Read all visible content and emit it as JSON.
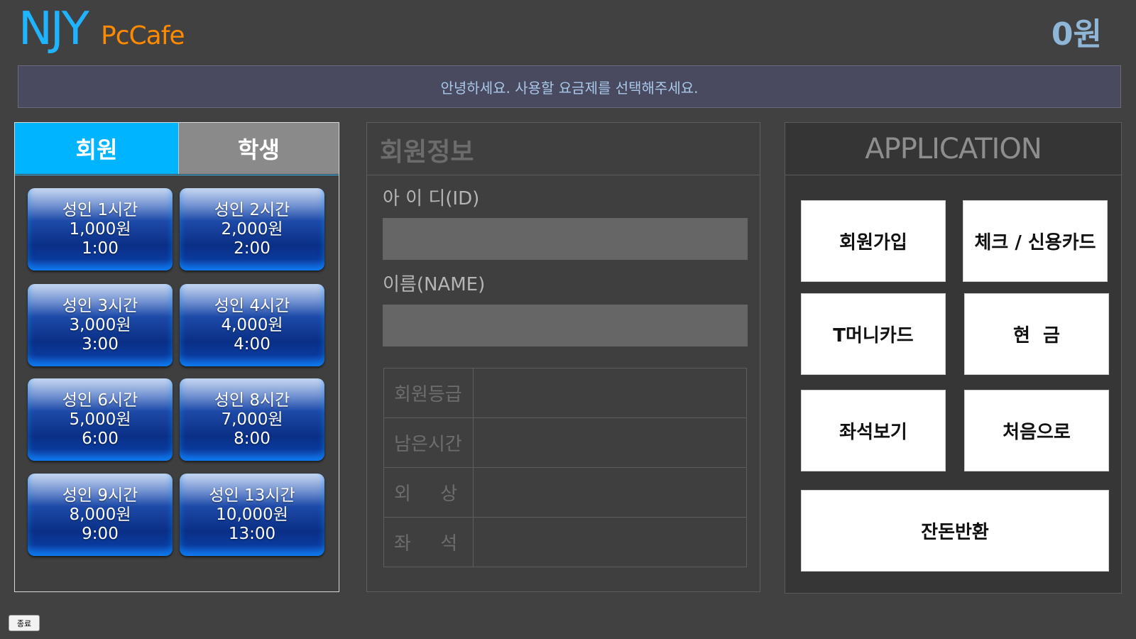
{
  "header": {
    "logo_main": "NJY",
    "logo_sub": "PcCafe",
    "balance": "0원"
  },
  "notice": "안녕하세요. 사용할 요금제를 선택해주세요.",
  "tabs": {
    "member": "회원",
    "student": "학생"
  },
  "plans": [
    {
      "name": "성인 1시간",
      "price": "1,000원",
      "time": "1:00"
    },
    {
      "name": "성인 2시간",
      "price": "2,000원",
      "time": "2:00"
    },
    {
      "name": "성인 3시간",
      "price": "3,000원",
      "time": "3:00"
    },
    {
      "name": "성인 4시간",
      "price": "4,000원",
      "time": "4:00"
    },
    {
      "name": "성인 6시간",
      "price": "5,000원",
      "time": "6:00"
    },
    {
      "name": "성인 8시간",
      "price": "7,000원",
      "time": "8:00"
    },
    {
      "name": "성인 9시간",
      "price": "8,000원",
      "time": "9:00"
    },
    {
      "name": "성인 13시간",
      "price": "10,000원",
      "time": "13:00"
    }
  ],
  "member_info": {
    "title": "회원정보",
    "id_label": "아 이 디(ID)",
    "id_value": "",
    "name_label": "이름(NAME)",
    "name_value": "",
    "rows": [
      {
        "label": "회원등급",
        "value": ""
      },
      {
        "label": "남은시간",
        "value": ""
      },
      {
        "label": "외     상",
        "value": ""
      },
      {
        "label": "좌     석",
        "value": ""
      }
    ]
  },
  "application": {
    "title": "APPLICATION",
    "buttons": {
      "signup": "회원가입",
      "card": "체크 / 신용카드",
      "tmoney": "T머니카드",
      "cash": "현  금",
      "seats": "좌석보기",
      "home": "처음으로",
      "change": "잔돈반환"
    }
  },
  "exit_label": "종료"
}
